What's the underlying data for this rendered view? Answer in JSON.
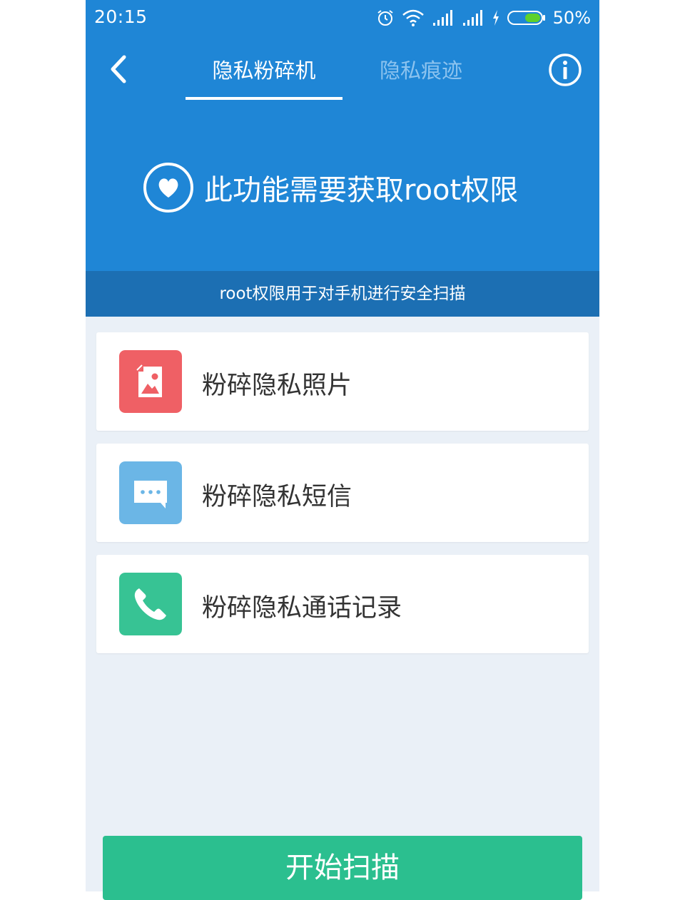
{
  "status_bar": {
    "time": "20:15",
    "battery": "50%"
  },
  "nav": {
    "tabs": [
      {
        "label": "隐私粉碎机",
        "active": true
      },
      {
        "label": "隐私痕迹",
        "active": false
      }
    ]
  },
  "hero": {
    "message": "此功能需要获取root权限"
  },
  "banner": {
    "text": "root权限用于对手机进行安全扫描"
  },
  "items": [
    {
      "label": "粉碎隐私照片",
      "icon": "photo-icon",
      "color": "#ef6065"
    },
    {
      "label": "粉碎隐私短信",
      "icon": "message-icon",
      "color": "#6bb6e6"
    },
    {
      "label": "粉碎隐私通话记录",
      "icon": "phone-icon",
      "color": "#37c394"
    }
  ],
  "start_button": {
    "label": "开始扫描"
  },
  "colors": {
    "primary": "#1f86d6",
    "banner": "#1c6fb3",
    "button": "#2bbf8f",
    "background": "#eaf0f7"
  }
}
